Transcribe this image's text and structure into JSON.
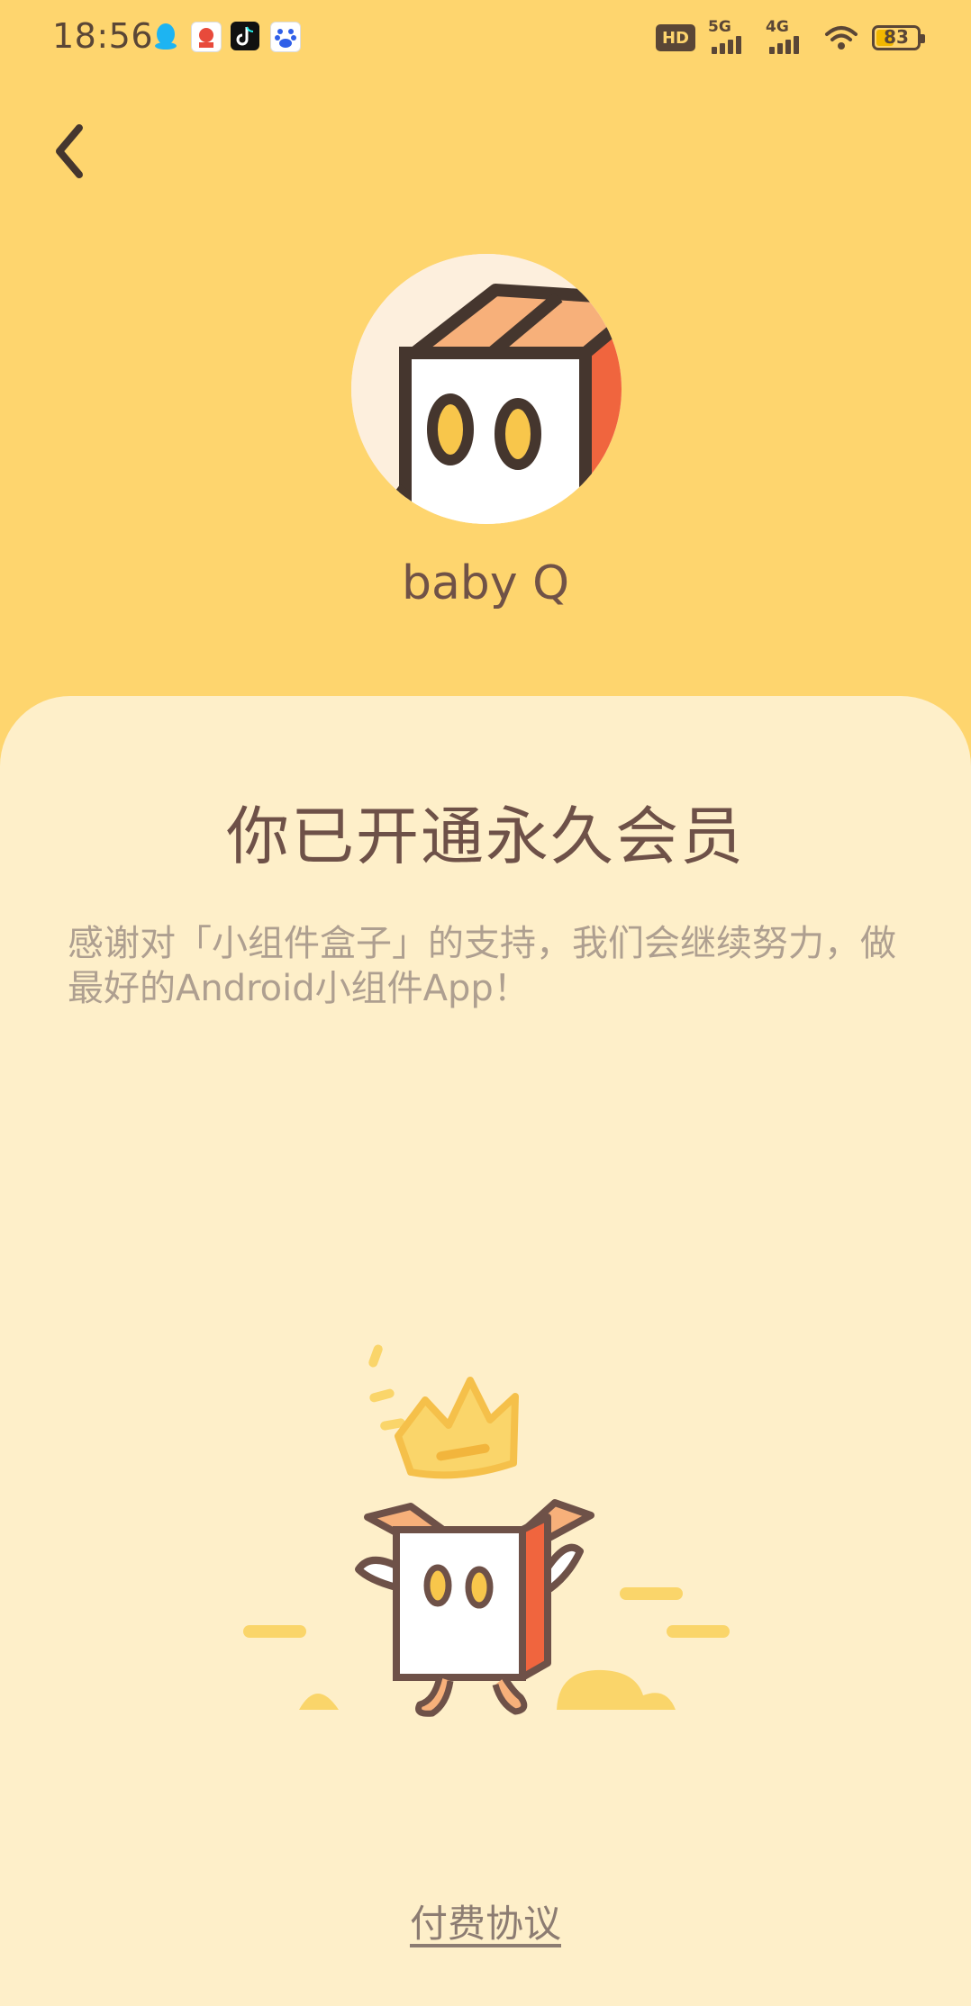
{
  "status_bar": {
    "time": "18:56",
    "hd_label": "HD",
    "network_1": "5G",
    "network_2": "4G",
    "battery": "83"
  },
  "header": {
    "back_icon": "chevron-left-icon",
    "user_name": "baby Q"
  },
  "card": {
    "title": "你已开通永久会员",
    "description": "感谢对「小组件盒子」的支持，我们会继续努力，做最好的Android小组件App！",
    "agreement_link": "付费协议"
  },
  "colors": {
    "header_bg": "#FED56E",
    "card_bg": "#FEEFC9",
    "title_text": "#6E5148",
    "desc_text": "#AE9F90",
    "accent_orange": "#F0653E"
  }
}
